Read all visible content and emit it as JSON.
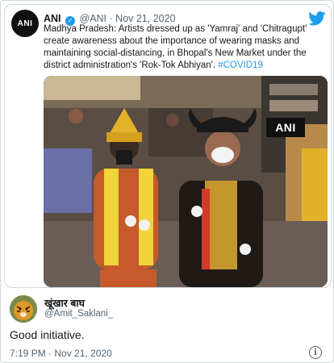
{
  "quoted": {
    "avatar_text": "ANI",
    "name": "ANI",
    "handle": "@ANI",
    "separator": " · ",
    "date": "Nov 21, 2020",
    "text": "Madhya Pradesh: Artists dressed up as 'Yamraj' and 'Chitragupt' create awareness about the importance of wearing masks and maintaining social-distancing, in Bhopal's New Market under the district administration's 'Rok-Tok Abhiyan'. ",
    "hashtag": "#COVID19",
    "media_watermark": "ANI"
  },
  "tweet": {
    "name": "खूंखार बाघ",
    "handle": "@Amit_Saklani_",
    "text": "Good initiative.",
    "timestamp": "7:19 PM · Nov 21, 2020"
  },
  "colors": {
    "accent": "#1d9bf0",
    "text": "#14171a",
    "secondary": "#536471"
  },
  "icons": [
    "verified-badge-icon",
    "twitter-bird-icon",
    "info-icon"
  ]
}
